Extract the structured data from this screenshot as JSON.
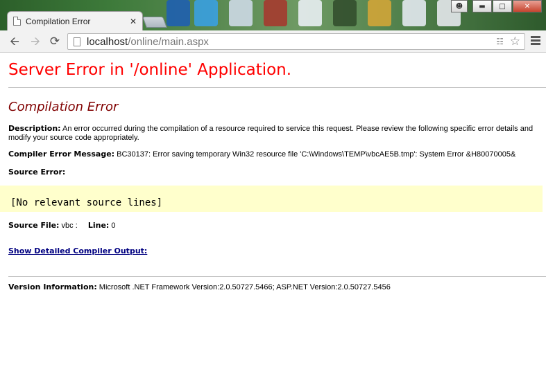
{
  "browser": {
    "tab_title": "Compilation Error",
    "tab_close": "✕",
    "url_host": "localhost",
    "url_path": "/online/main.aspx"
  },
  "page": {
    "heading": "Server Error in '/online' Application.",
    "subheading": "Compilation Error",
    "description_label": "Description:",
    "description_text": "An error occurred during the compilation of a resource required to service this request. Please review the following specific error details and modify your source code appropriately.",
    "compiler_msg_label": "Compiler Error Message:",
    "compiler_msg_text": "BC30137: Error saving temporary Win32 resource file 'C:\\Windows\\TEMP\\vbcAE5B.tmp': System Error &H80070005&",
    "source_error_label": "Source Error:",
    "source_code": "[No relevant source lines]",
    "source_file_label": "Source File:",
    "source_file_value": "vbc :",
    "line_label": "Line:",
    "line_value": "0",
    "detail_link": "Show Detailed Compiler Output:",
    "version_label": "Version Information:",
    "version_text": "Microsoft .NET Framework Version:2.0.50727.5466; ASP.NET Version:2.0.50727.5456"
  },
  "colors": {
    "heading": "#ff0000",
    "subheading": "#800000",
    "code_bg": "#ffffcc",
    "link": "#000080"
  }
}
